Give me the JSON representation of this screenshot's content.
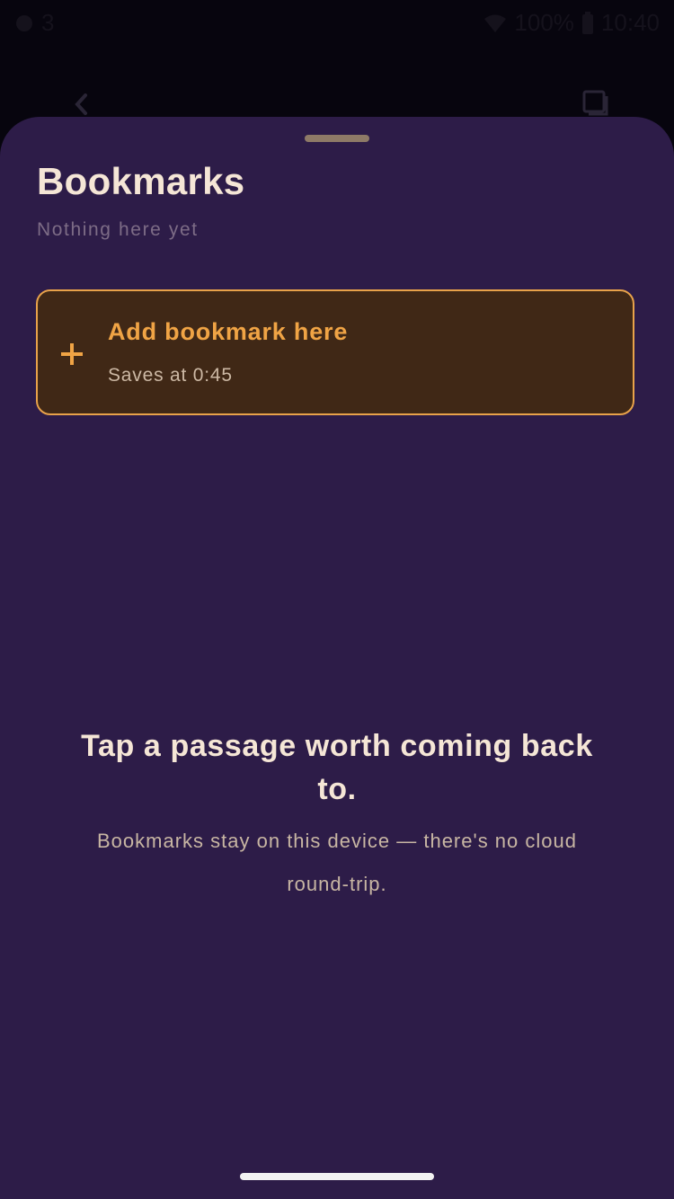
{
  "status_bar": {
    "notification_count": "3",
    "battery": "100%",
    "time": "10:40"
  },
  "sheet": {
    "title": "Bookmarks",
    "subtitle": "Nothing here yet",
    "add_card": {
      "title": "Add bookmark here",
      "subtitle": "Saves at 0:45",
      "icon": "plus-icon"
    },
    "empty_state": {
      "headline": "Tap a passage worth coming back to.",
      "body": "Bookmarks stay on this device — there's no cloud round-trip."
    }
  },
  "colors": {
    "sheet_background": "#2d1c48",
    "accent": "#f0a445",
    "card_background": "#402816",
    "title_text": "#f5e6d6"
  }
}
